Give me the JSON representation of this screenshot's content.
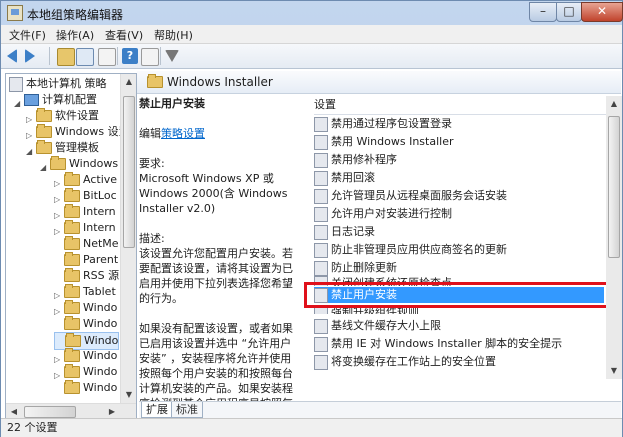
{
  "window": {
    "title": "本地组策略编辑器",
    "min_label": "–",
    "max_label": "□",
    "close_label": "✕"
  },
  "menu": [
    "文件(F)",
    "操作(A)",
    "查看(V)",
    "帮助(H)"
  ],
  "toolbar": {
    "help_label": "?"
  },
  "tree": {
    "root": "本地计算机 策略",
    "items": [
      {
        "label": "计算机配置",
        "level": 1
      },
      {
        "label": "软件设置",
        "level": 2
      },
      {
        "label": "Windows 设置",
        "level": 2
      },
      {
        "label": "管理模板",
        "level": 2
      },
      {
        "label": "Windows",
        "level": 3
      },
      {
        "label": "Active",
        "level": 4
      },
      {
        "label": "BitLoc",
        "level": 4
      },
      {
        "label": "Intern",
        "level": 4
      },
      {
        "label": "Intern",
        "level": 4
      },
      {
        "label": "NetMe",
        "level": 4
      },
      {
        "label": "Parent",
        "level": 4
      },
      {
        "label": "RSS 源",
        "level": 4
      },
      {
        "label": "Tablet",
        "level": 4
      },
      {
        "label": "Windo",
        "level": 4
      },
      {
        "label": "Windo",
        "level": 4
      },
      {
        "label": "Windo",
        "level": 4
      },
      {
        "label": "Windo",
        "level": 4
      },
      {
        "label": "Windo",
        "level": 4
      },
      {
        "label": "Windo",
        "level": 4
      }
    ]
  },
  "header": {
    "title": "Windows Installer"
  },
  "description": {
    "title": "禁止用户安装",
    "edit_prefix": "编辑",
    "edit_link": "策略设置",
    "req_label": "要求:",
    "req_text": "Microsoft Windows XP 或 Windows 2000(含 Windows Installer v2.0)",
    "desc_label": "描述:",
    "desc_text": "该设置允许您配置用户安装。若要配置该设置，请将其设置为已启用并使用下拉列表选择您希望的行为。",
    "desc_text2": "如果没有配置该设置，或者如果已启用该设置并选中 “允许用户安装” ，安装程序将允许并使用按照每个用户安装的和按照每台计算机安装的产品。如果安装程序检测到某个应用程序是按照每个用户安装的，并按照该产品以前的安装方式安装"
  },
  "settings": {
    "header": "设置",
    "rows": [
      "禁用通过程序包设置登录",
      "禁用 Windows Installer",
      "禁用修补程序",
      "禁用回滚",
      "允许管理员从远程桌面服务会话安装",
      "允许用户对安装进行控制",
      "日志记录",
      "防止非管理员应用供应商签名的更新",
      "防止删除更新",
      "关闭创建系统还原检查点",
      "禁止用户安装",
      "强制升级组件规则",
      "基线文件缓存大小上限",
      "禁用 IE 对 Windows Installer 脚本的安全提示",
      "将变换缓存在工作站上的安全位置"
    ],
    "selected_index": 10
  },
  "tabs": [
    "扩展",
    "标准"
  ],
  "status": {
    "text": "22 个设置"
  }
}
